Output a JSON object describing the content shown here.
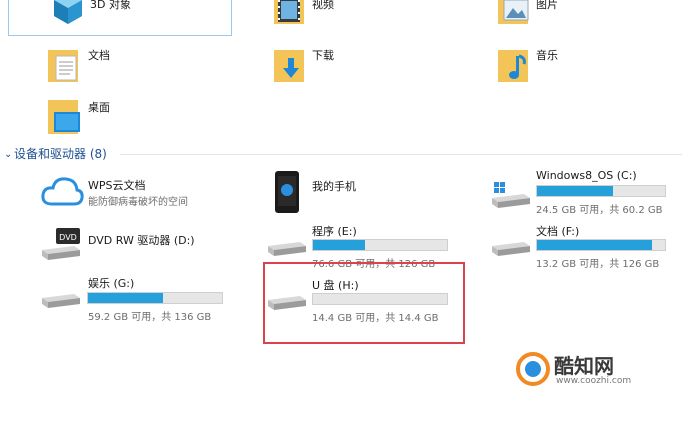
{
  "folders": [
    {
      "id": "objects3d",
      "label": "3D 对象",
      "icon": "cube-icon"
    },
    {
      "id": "videos",
      "label": "视频",
      "icon": "film-icon"
    },
    {
      "id": "pictures",
      "label": "图片",
      "icon": "picture-icon"
    },
    {
      "id": "documents",
      "label": "文档",
      "icon": "document-icon"
    },
    {
      "id": "downloads",
      "label": "下载",
      "icon": "download-arrow-icon"
    },
    {
      "id": "music",
      "label": "音乐",
      "icon": "music-note-icon"
    },
    {
      "id": "desktop",
      "label": "桌面",
      "icon": "monitor-icon"
    }
  ],
  "section": {
    "title": "设备和驱动器 (8)"
  },
  "devices": [
    {
      "id": "wps",
      "label": "WPS云文档",
      "sub": "能防御病毒破坏的空间"
    },
    {
      "id": "phone",
      "label": "我的手机"
    },
    {
      "id": "windows",
      "label": "Windows8_OS (C:)",
      "free": "24.5 GB 可用，共 60.2 GB",
      "used_fraction": 0.59
    },
    {
      "id": "dvd",
      "label": "DVD RW 驱动器 (D:)"
    },
    {
      "id": "e",
      "label": "程序 (E:)",
      "free": "76.6 GB 可用，共 126 GB",
      "used_fraction": 0.39
    },
    {
      "id": "f",
      "label": "文档 (F:)",
      "free": "13.2 GB 可用，共 126 GB",
      "used_fraction": 0.9
    },
    {
      "id": "g",
      "label": "娱乐 (G:)",
      "free": "59.2 GB 可用，共 136 GB",
      "used_fraction": 0.56
    },
    {
      "id": "h",
      "label": "U 盘 (H:)",
      "free": "14.4 GB 可用，共 14.4 GB",
      "used_fraction": 0.0
    }
  ],
  "watermark": {
    "name": "酷知网",
    "url": "www.coozhi.com"
  },
  "colors": {
    "accent": "#26a0da",
    "highlight": "#d9434e",
    "selection": "#99c9ef",
    "section": "#1e4f92"
  }
}
